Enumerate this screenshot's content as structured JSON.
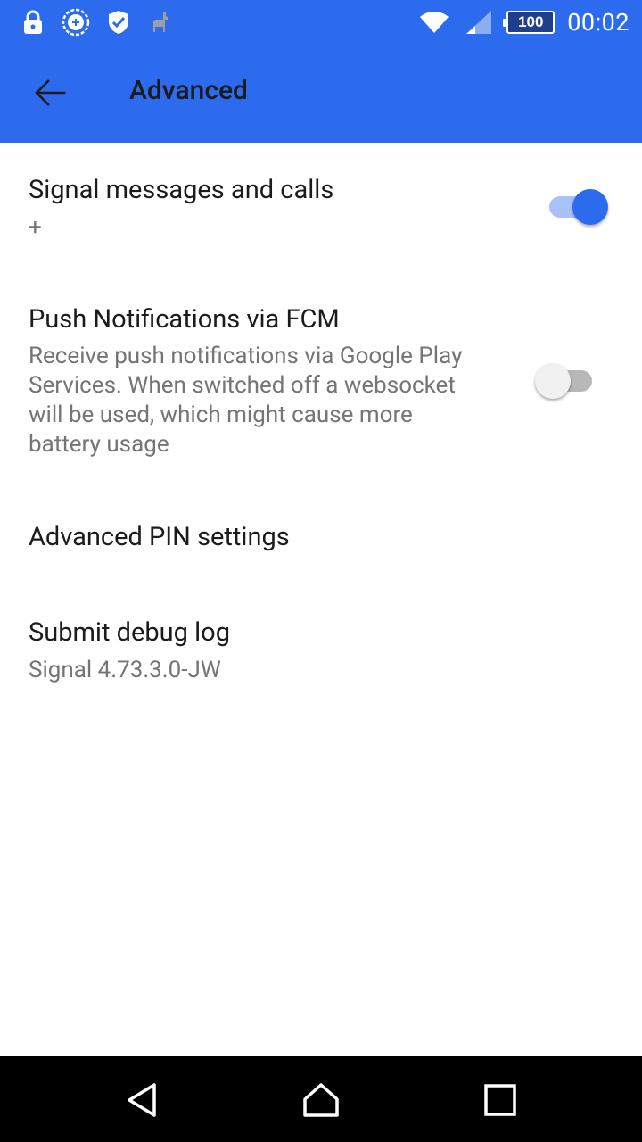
{
  "status_bar": {
    "left_icons": [
      "lock-icon",
      "signal-status-icon",
      "shield-check-icon",
      "llama-icon"
    ],
    "right_icons": [
      "wifi-icon",
      "cell-signal-icon"
    ],
    "battery_level": "100",
    "time": "00:02"
  },
  "toolbar": {
    "back_icon": "arrow-back-icon",
    "title": "Advanced",
    "color": "#2c6bed"
  },
  "preferences": [
    {
      "title": "Signal messages and calls",
      "summary": "+",
      "switch_on": true
    },
    {
      "title": "Push Notifications via FCM",
      "summary_lines": [
        "Receive push notifications via Google Play",
        "Services. When switched off a websocket",
        "will be used, which might cause more",
        "battery usage"
      ],
      "switch_on": false
    },
    {
      "title": "Advanced PIN settings"
    },
    {
      "title": "Submit debug log",
      "summary": "Signal 4.73.3.0-JW"
    }
  ],
  "nav_bar": {
    "buttons": [
      "back-triangle-icon",
      "home-icon",
      "recents-icon"
    ]
  },
  "colors": {
    "accent": "#2c6bed",
    "switch_track_on": "#a9c1f7",
    "text_primary": "#1b1b1b",
    "text_secondary": "#757575"
  }
}
